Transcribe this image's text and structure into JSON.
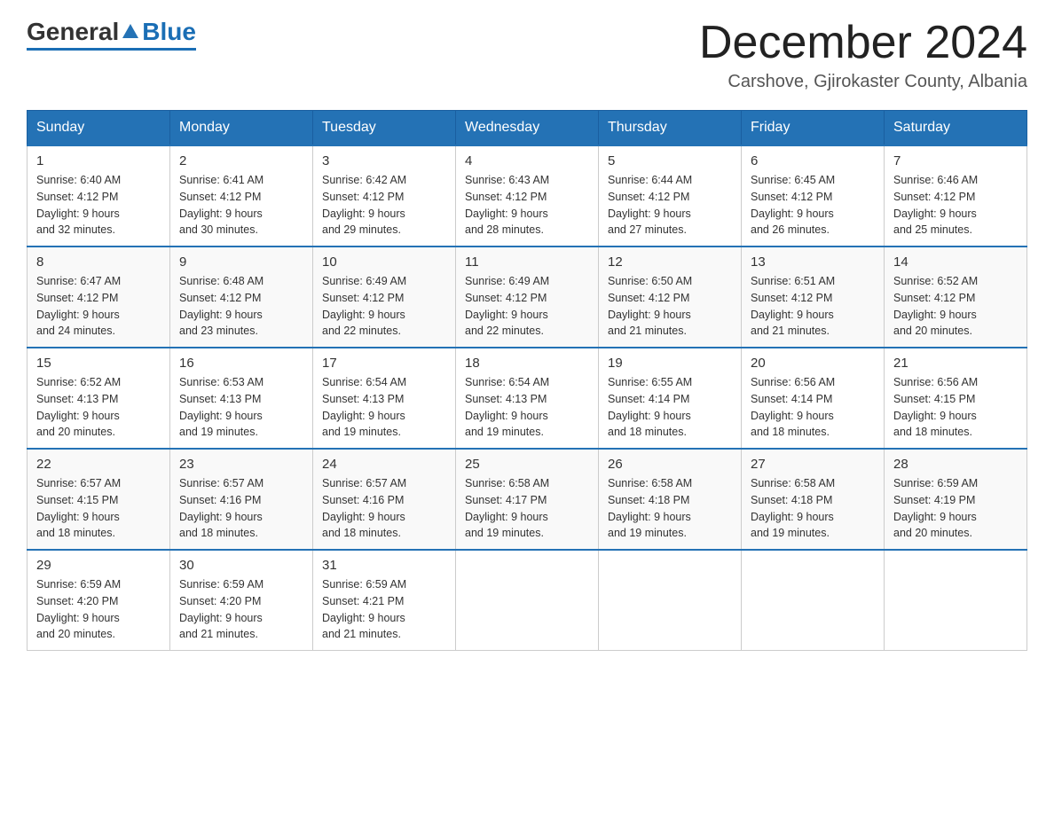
{
  "logo": {
    "general": "General",
    "blue": "Blue"
  },
  "header": {
    "month_title": "December 2024",
    "location": "Carshove, Gjirokaster County, Albania"
  },
  "days_of_week": [
    "Sunday",
    "Monday",
    "Tuesday",
    "Wednesday",
    "Thursday",
    "Friday",
    "Saturday"
  ],
  "weeks": [
    [
      {
        "day": "1",
        "sunrise": "6:40 AM",
        "sunset": "4:12 PM",
        "daylight": "9 hours and 32 minutes."
      },
      {
        "day": "2",
        "sunrise": "6:41 AM",
        "sunset": "4:12 PM",
        "daylight": "9 hours and 30 minutes."
      },
      {
        "day": "3",
        "sunrise": "6:42 AM",
        "sunset": "4:12 PM",
        "daylight": "9 hours and 29 minutes."
      },
      {
        "day": "4",
        "sunrise": "6:43 AM",
        "sunset": "4:12 PM",
        "daylight": "9 hours and 28 minutes."
      },
      {
        "day": "5",
        "sunrise": "6:44 AM",
        "sunset": "4:12 PM",
        "daylight": "9 hours and 27 minutes."
      },
      {
        "day": "6",
        "sunrise": "6:45 AM",
        "sunset": "4:12 PM",
        "daylight": "9 hours and 26 minutes."
      },
      {
        "day": "7",
        "sunrise": "6:46 AM",
        "sunset": "4:12 PM",
        "daylight": "9 hours and 25 minutes."
      }
    ],
    [
      {
        "day": "8",
        "sunrise": "6:47 AM",
        "sunset": "4:12 PM",
        "daylight": "9 hours and 24 minutes."
      },
      {
        "day": "9",
        "sunrise": "6:48 AM",
        "sunset": "4:12 PM",
        "daylight": "9 hours and 23 minutes."
      },
      {
        "day": "10",
        "sunrise": "6:49 AM",
        "sunset": "4:12 PM",
        "daylight": "9 hours and 22 minutes."
      },
      {
        "day": "11",
        "sunrise": "6:49 AM",
        "sunset": "4:12 PM",
        "daylight": "9 hours and 22 minutes."
      },
      {
        "day": "12",
        "sunrise": "6:50 AM",
        "sunset": "4:12 PM",
        "daylight": "9 hours and 21 minutes."
      },
      {
        "day": "13",
        "sunrise": "6:51 AM",
        "sunset": "4:12 PM",
        "daylight": "9 hours and 21 minutes."
      },
      {
        "day": "14",
        "sunrise": "6:52 AM",
        "sunset": "4:12 PM",
        "daylight": "9 hours and 20 minutes."
      }
    ],
    [
      {
        "day": "15",
        "sunrise": "6:52 AM",
        "sunset": "4:13 PM",
        "daylight": "9 hours and 20 minutes."
      },
      {
        "day": "16",
        "sunrise": "6:53 AM",
        "sunset": "4:13 PM",
        "daylight": "9 hours and 19 minutes."
      },
      {
        "day": "17",
        "sunrise": "6:54 AM",
        "sunset": "4:13 PM",
        "daylight": "9 hours and 19 minutes."
      },
      {
        "day": "18",
        "sunrise": "6:54 AM",
        "sunset": "4:13 PM",
        "daylight": "9 hours and 19 minutes."
      },
      {
        "day": "19",
        "sunrise": "6:55 AM",
        "sunset": "4:14 PM",
        "daylight": "9 hours and 18 minutes."
      },
      {
        "day": "20",
        "sunrise": "6:56 AM",
        "sunset": "4:14 PM",
        "daylight": "9 hours and 18 minutes."
      },
      {
        "day": "21",
        "sunrise": "6:56 AM",
        "sunset": "4:15 PM",
        "daylight": "9 hours and 18 minutes."
      }
    ],
    [
      {
        "day": "22",
        "sunrise": "6:57 AM",
        "sunset": "4:15 PM",
        "daylight": "9 hours and 18 minutes."
      },
      {
        "day": "23",
        "sunrise": "6:57 AM",
        "sunset": "4:16 PM",
        "daylight": "9 hours and 18 minutes."
      },
      {
        "day": "24",
        "sunrise": "6:57 AM",
        "sunset": "4:16 PM",
        "daylight": "9 hours and 18 minutes."
      },
      {
        "day": "25",
        "sunrise": "6:58 AM",
        "sunset": "4:17 PM",
        "daylight": "9 hours and 19 minutes."
      },
      {
        "day": "26",
        "sunrise": "6:58 AM",
        "sunset": "4:18 PM",
        "daylight": "9 hours and 19 minutes."
      },
      {
        "day": "27",
        "sunrise": "6:58 AM",
        "sunset": "4:18 PM",
        "daylight": "9 hours and 19 minutes."
      },
      {
        "day": "28",
        "sunrise": "6:59 AM",
        "sunset": "4:19 PM",
        "daylight": "9 hours and 20 minutes."
      }
    ],
    [
      {
        "day": "29",
        "sunrise": "6:59 AM",
        "sunset": "4:20 PM",
        "daylight": "9 hours and 20 minutes."
      },
      {
        "day": "30",
        "sunrise": "6:59 AM",
        "sunset": "4:20 PM",
        "daylight": "9 hours and 21 minutes."
      },
      {
        "day": "31",
        "sunrise": "6:59 AM",
        "sunset": "4:21 PM",
        "daylight": "9 hours and 21 minutes."
      },
      {
        "day": "",
        "sunrise": "",
        "sunset": "",
        "daylight": ""
      },
      {
        "day": "",
        "sunrise": "",
        "sunset": "",
        "daylight": ""
      },
      {
        "day": "",
        "sunrise": "",
        "sunset": "",
        "daylight": ""
      },
      {
        "day": "",
        "sunrise": "",
        "sunset": "",
        "daylight": ""
      }
    ]
  ],
  "labels": {
    "sunrise": "Sunrise:",
    "sunset": "Sunset:",
    "daylight": "Daylight:"
  }
}
